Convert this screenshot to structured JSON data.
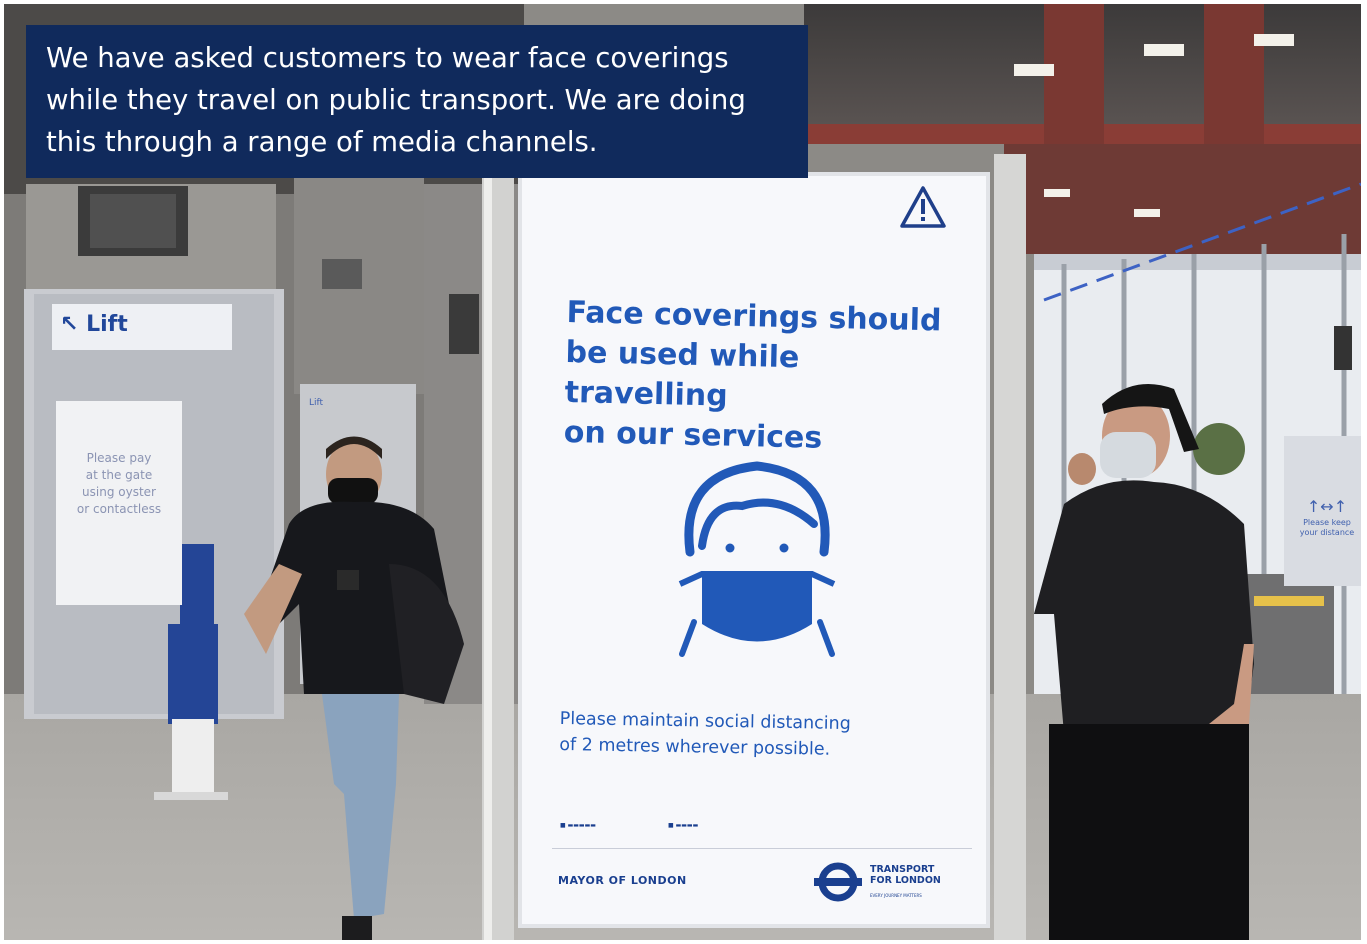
{
  "caption": {
    "lines": [
      "We have asked customers to wear face coverings",
      "while they travel on public transport. We are doing",
      "this through a range of media channels."
    ]
  },
  "poster": {
    "warning_icon": "warning-triangle-icon",
    "headline_lines": [
      "Face coverings should",
      "be used while travelling",
      "on our services"
    ],
    "illustration_icon": "face-mask-person-icon",
    "subtext_lines": [
      "Please maintain social distancing",
      "of 2 metres wherever possible."
    ],
    "footer_left": "MAYOR OF LONDON",
    "footer_right_lines": [
      "TRANSPORT",
      "FOR LONDON"
    ],
    "footer_right_small": "EVERY JOURNEY MATTERS",
    "roundel_icon": "tfl-roundel-icon",
    "colors": {
      "blue": "#2159b8",
      "dark_blue": "#1a3f8f",
      "paper": "#f7f8fb"
    }
  },
  "background": {
    "lift_sign": "Lift",
    "lift_sign_secondary": "Lift",
    "pay_board_lines": [
      "Please pay",
      "at the gate",
      "using oyster",
      "or contactless"
    ],
    "right_board_lines": [
      "Please keep",
      "your distance"
    ]
  },
  "colors": {
    "caption_bg": "#102a5c",
    "caption_text": "#ffffff"
  }
}
